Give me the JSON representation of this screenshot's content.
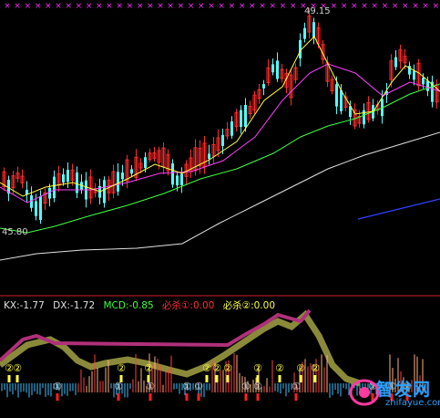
{
  "colors": {
    "background": "#000000",
    "up_candle": "#ff2a2a",
    "down_candle": "#54ffff",
    "ma_white": "#e0e0e0",
    "ma_yellow": "#ffff40",
    "ma_magenta": "#ff40ff",
    "ma_green": "#40ff40",
    "trend_blue": "#3040ff",
    "marker_magenta": "#ff2aff",
    "separator": "#d02020",
    "kx": "#e0e0e0",
    "dx": "#e0e0e0",
    "mcd": "#40ff40",
    "bisha1": "#ff3030",
    "bisha2": "#ffff40"
  },
  "price_labels": {
    "high": "49.15",
    "low": "45.80"
  },
  "indicator": {
    "kx": "KX:-1.77",
    "dx": "DX:-1.72",
    "mcd": "MCD:-0.85",
    "bisha1": "必杀①:0.00",
    "bisha2": "必杀②:0.00"
  },
  "signals": {
    "two": "②",
    "one": "①"
  },
  "watermark": {
    "main": "智发网",
    "sub": "zhifayue.com"
  },
  "chart_data": {
    "type": "candlestick",
    "title": "",
    "high_label": 49.15,
    "low_label": 45.8,
    "indicator_values": {
      "KX": -1.77,
      "DX": -1.72,
      "MCD": -0.85,
      "必杀①": 0.0,
      "必杀②": 0.0
    }
  }
}
